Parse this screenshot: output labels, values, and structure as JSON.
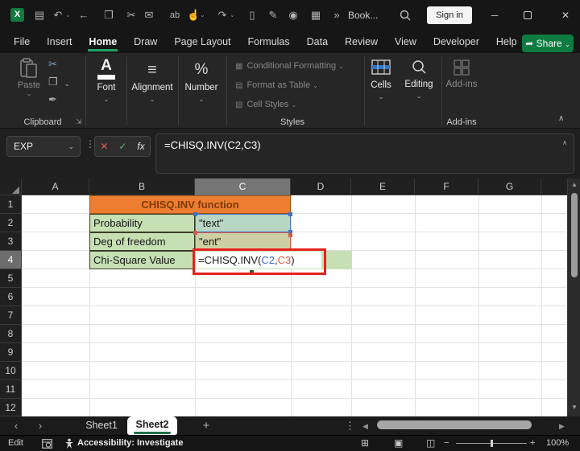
{
  "colors": {
    "excel_green": "#107C41",
    "tab_underline_green": "#21A366",
    "share_green": "#0e7c41",
    "table_header_orange": "#ED7D31",
    "table_header_text": "#7e3a00",
    "table_fill_green": "#C6E0B4",
    "ref_blue": "#4472C4",
    "ref_red": "#CF5B49",
    "annotation_red": "#E8211D"
  },
  "icons": {
    "chevron_down": "⌄",
    "chevron_up": "∧",
    "cancel": "✕",
    "enter": "✓",
    "minimize": "─",
    "close": "✕",
    "prev": "‹",
    "next": "›",
    "dots_v": "⋮",
    "left": "◀",
    "right": "▶",
    "up": "▲",
    "down": "▼",
    "minus": "−",
    "plus": "+",
    "font_glyph": "A",
    "align_glyph": "≡",
    "number_glyph": "%",
    "styles_glyphs": [
      "▦",
      "▤",
      "▧"
    ],
    "view_normal": "⊞",
    "view_page_layout": "▣",
    "view_page_break": "◫",
    "launcher": "⇲"
  },
  "title_bar": {
    "logo_text": "X",
    "workbook_title": "Book...",
    "sign_in": "Sign in",
    "qat": [
      {
        "name": "save",
        "glyph": "▤"
      },
      {
        "name": "undo",
        "glyph": "↶"
      },
      {
        "name": "back",
        "glyph": "←"
      },
      {
        "name": "copy",
        "glyph": "❐"
      },
      {
        "name": "cut",
        "glyph": "✂"
      },
      {
        "name": "mail",
        "glyph": "✉"
      },
      {
        "name": "find-replace",
        "glyph": "ab"
      },
      {
        "name": "touch-mode",
        "glyph": "☝"
      },
      {
        "name": "redo",
        "glyph": "↷"
      },
      {
        "name": "new-file",
        "glyph": "▯"
      },
      {
        "name": "format",
        "glyph": "✎"
      },
      {
        "name": "camera",
        "glyph": "◉"
      },
      {
        "name": "lookup",
        "glyph": "▦"
      },
      {
        "name": "overflow",
        "glyph": "»"
      }
    ]
  },
  "ribbon_tabs": {
    "items": [
      "File",
      "Insert",
      "Home",
      "Draw",
      "Page Layout",
      "Formulas",
      "Data",
      "Review",
      "View",
      "Developer",
      "Help"
    ],
    "active": "Home",
    "share": "Share"
  },
  "ribbon": {
    "paste": "Paste",
    "font": "Font",
    "alignment": "Alignment",
    "number": "Number",
    "cells": "Cells",
    "editing": "Editing",
    "addins_button": "Add-ins",
    "group_labels": {
      "clipboard": "Clipboard",
      "styles": "Styles",
      "addins": "Add-ins"
    },
    "styles_menu": [
      "Conditional Formatting",
      "Format as Table",
      "Cell Styles"
    ]
  },
  "formula_bar": {
    "name_box": "EXP",
    "fx": "fx",
    "formula": "=CHISQ.INV(C2,C3)"
  },
  "grid": {
    "columns": [
      "A",
      "B",
      "C",
      "D",
      "E",
      "F",
      "G"
    ],
    "rows": [
      "1",
      "2",
      "3",
      "4",
      "5",
      "6",
      "7",
      "8",
      "9",
      "10",
      "11",
      "12"
    ],
    "active_column": "C",
    "active_row": "4",
    "table": {
      "title": "CHISQ.INV function",
      "rows": [
        {
          "label": "Probability",
          "value": "\"text\""
        },
        {
          "label": "Deg of freedom",
          "value": "\"ent\""
        },
        {
          "label": "Chi-Square Value",
          "value": "=CHISQ.INV(C2,C3)"
        }
      ]
    },
    "formula_parts": {
      "prefix": "=CHISQ.INV(",
      "ref1": "C2",
      "comma": ",",
      "ref2": "C3",
      "suffix": ")"
    }
  },
  "sheet_bar": {
    "tabs": [
      "Sheet1",
      "Sheet2"
    ],
    "active": "Sheet2",
    "add": "+"
  },
  "status_bar": {
    "mode": "Edit",
    "accessibility": "Accessibility: Investigate",
    "zoom_level": "100%"
  }
}
